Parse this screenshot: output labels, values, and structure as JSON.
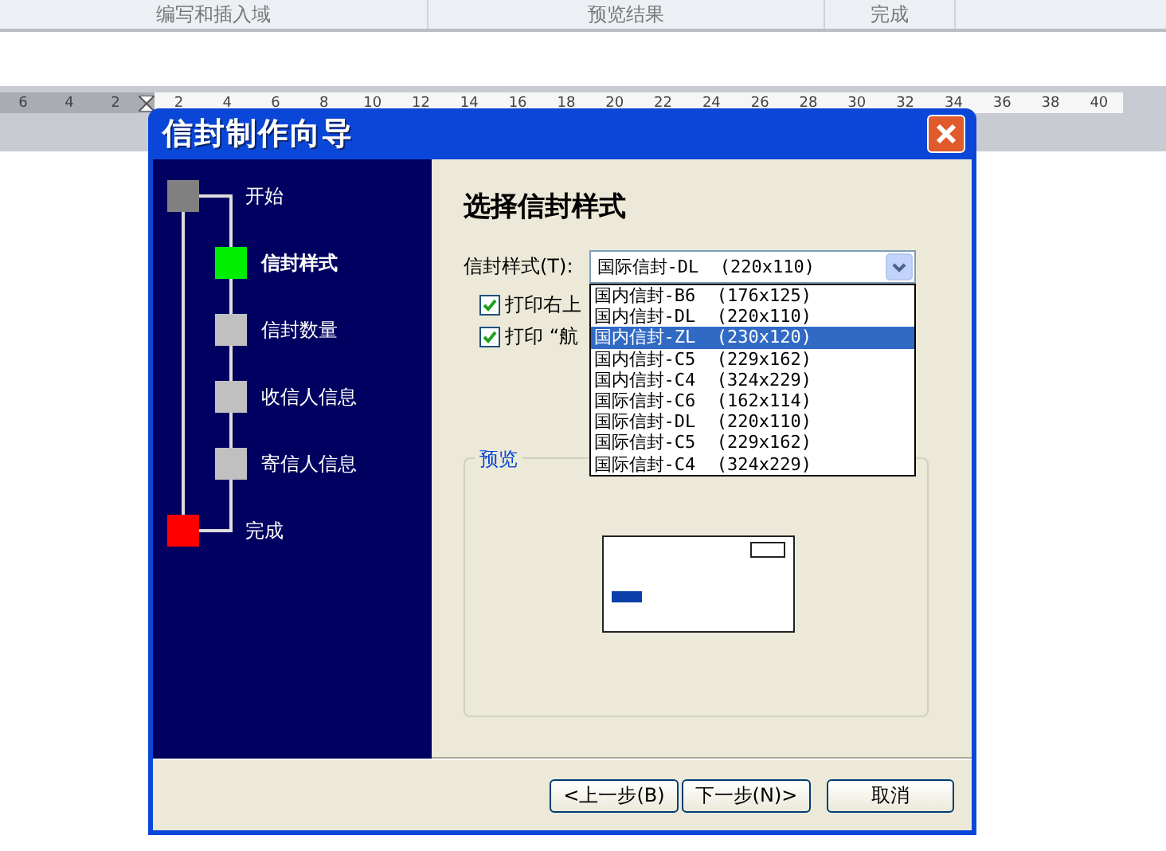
{
  "ribbon_groups": [
    "编写和插入域",
    "预览结果",
    "完成"
  ],
  "ruler": {
    "left_numbers": [
      "6",
      "4",
      "2"
    ],
    "right_numbers": [
      "2",
      "4",
      "6",
      "8",
      "10",
      "12",
      "14",
      "16",
      "18",
      "20",
      "22",
      "24",
      "26",
      "28",
      "30",
      "32",
      "34",
      "36",
      "38",
      "40"
    ]
  },
  "dialog": {
    "title": "信封制作向导",
    "steps": [
      {
        "label": "开始",
        "kind": "start",
        "selected": false
      },
      {
        "label": "信封样式",
        "kind": "middle",
        "selected": true
      },
      {
        "label": "信封数量",
        "kind": "middle",
        "selected": false
      },
      {
        "label": "收信人信息",
        "kind": "middle",
        "selected": false
      },
      {
        "label": "寄信人信息",
        "kind": "middle",
        "selected": false
      },
      {
        "label": "完成",
        "kind": "finish",
        "selected": false
      }
    ],
    "heading": "选择信封样式",
    "style_label": "信封样式(T):",
    "style_value": "国际信封-DL  (220x110)",
    "style_options": [
      {
        "label": "国内信封-B6  (176x125)",
        "selected": false
      },
      {
        "label": "国内信封-DL  (220x110)",
        "selected": false
      },
      {
        "label": "国内信封-ZL  (230x120)",
        "selected": true
      },
      {
        "label": "国内信封-C5  (229x162)",
        "selected": false
      },
      {
        "label": "国内信封-C4  (324x229)",
        "selected": false
      },
      {
        "label": "国际信封-C6  (162x114)",
        "selected": false
      },
      {
        "label": "国际信封-DL  (220x110)",
        "selected": false
      },
      {
        "label": "国际信封-C5  (229x162)",
        "selected": false
      },
      {
        "label": "国际信封-C4  (324x229)",
        "selected": false
      }
    ],
    "checkboxes": [
      {
        "label": "打印右上",
        "checked": true
      },
      {
        "label": "打印 “航",
        "checked": true
      }
    ],
    "preview_label": "预览",
    "buttons": [
      "<上一步(B)",
      "下一步(N)>",
      "取消"
    ]
  }
}
